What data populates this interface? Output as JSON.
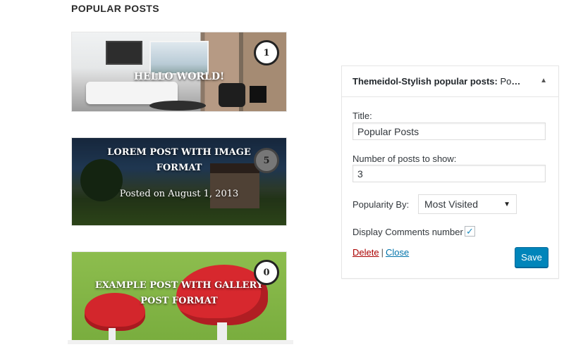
{
  "preview": {
    "heading": "POPULAR POSTS",
    "posts": [
      {
        "title": "HELLO WORLD!",
        "comments": "1"
      },
      {
        "title": "LOREM POST WITH IMAGE FORMAT",
        "meta": "Posted on August 1, 2013",
        "comments": "5"
      },
      {
        "title": "EXAMPLE POST WITH GALLERY POST FORMAT",
        "comments": "0"
      }
    ]
  },
  "widget": {
    "header_title": "Themeidol-Stylish popular posts:",
    "header_sub": " Popular Posts",
    "toggle_icon": "triangle-up-icon",
    "title_label": "Title:",
    "title_value": "Popular Posts",
    "count_label": "Number of posts to show:",
    "count_value": "3",
    "popularity_label": "Popularity By:",
    "popularity_value": "Most Visited",
    "comments_label": "Display Comments number",
    "comments_checked": true,
    "delete_label": "Delete",
    "separator": "|",
    "close_label": "Close",
    "save_label": "Save"
  },
  "colors": {
    "primary_button": "#0085ba",
    "delete_link": "#a00",
    "link": "#0073aa"
  }
}
